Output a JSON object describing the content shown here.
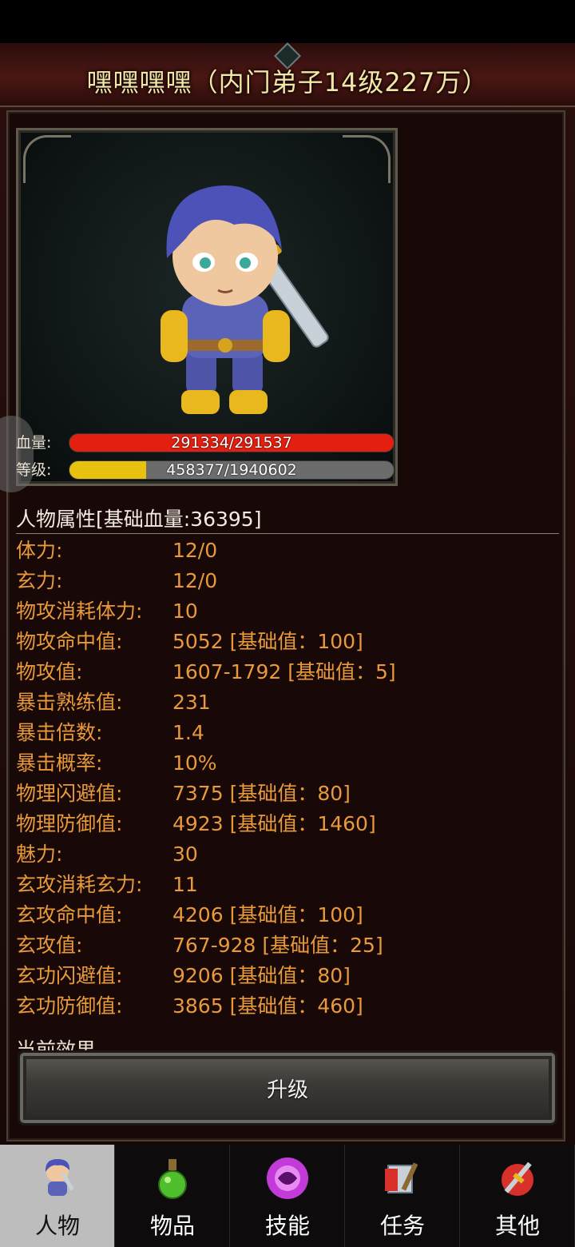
{
  "header": {
    "title": "嘿嘿嘿嘿（内门弟子14级227万）"
  },
  "character": {
    "hp": {
      "label": "血量:",
      "text": "291334/291537",
      "fraction": 0.9993,
      "color": "#e21f10"
    },
    "level": {
      "label": "等级:",
      "text": "458377/1940602",
      "fraction": 0.2362,
      "color": "#e8c20e"
    }
  },
  "attributes": {
    "header": "人物属性[基础血量:36395]",
    "rows": [
      {
        "key": "体力:",
        "value": "12/0"
      },
      {
        "key": "玄力:",
        "value": "12/0"
      },
      {
        "key": "物攻消耗体力:",
        "value": "10"
      },
      {
        "key": "物攻命中值:",
        "value": "5052 [基础值：100]"
      },
      {
        "key": "物攻值:",
        "value": "1607-1792 [基础值：5]"
      },
      {
        "key": "暴击熟练值:",
        "value": "231"
      },
      {
        "key": "暴击倍数:",
        "value": "1.4"
      },
      {
        "key": "暴击概率:",
        "value": "10%"
      },
      {
        "key": "物理闪避值:",
        "value": "7375 [基础值：80]"
      },
      {
        "key": "物理防御值:",
        "value": "4923 [基础值：1460]"
      },
      {
        "key": "魅力:",
        "value": "30"
      },
      {
        "key": "玄攻消耗玄力:",
        "value": "11"
      },
      {
        "key": "玄攻命中值:",
        "value": "4206 [基础值：100]"
      },
      {
        "key": "玄攻值:",
        "value": "767-928 [基础值：25]"
      },
      {
        "key": "玄功闪避值:",
        "value": "9206 [基础值：80]"
      },
      {
        "key": "玄功防御值:",
        "value": "3865 [基础值：460]"
      }
    ],
    "next_section_partial": "当前效果"
  },
  "actions": {
    "upgrade_label": "升级"
  },
  "nav": {
    "items": [
      {
        "label": "人物",
        "icon": "character-icon",
        "active": true
      },
      {
        "label": "物品",
        "icon": "potion-icon",
        "active": false
      },
      {
        "label": "技能",
        "icon": "skill-orb-icon",
        "active": false
      },
      {
        "label": "任务",
        "icon": "quest-icon",
        "active": false
      },
      {
        "label": "其他",
        "icon": "other-icon",
        "active": false
      }
    ]
  },
  "colors": {
    "attribute_text": "#e89a3a",
    "title_text": "#f5e6a6"
  }
}
